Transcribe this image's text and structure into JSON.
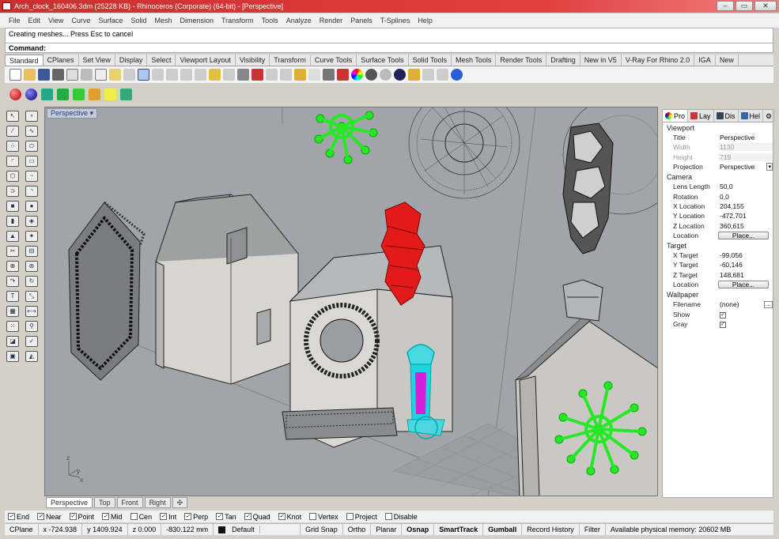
{
  "window": {
    "title": "Arch_clock_160406.3dm (25228 KB) - Rhinoceros (Corporate) (64-bit) - [Perspective]",
    "buttons": [
      "–",
      "▭",
      "✕"
    ]
  },
  "menu": [
    "File",
    "Edit",
    "View",
    "Curve",
    "Surface",
    "Solid",
    "Mesh",
    "Dimension",
    "Transform",
    "Tools",
    "Analyze",
    "Render",
    "Panels",
    "T-Splines",
    "Help"
  ],
  "command": {
    "history": "Creating meshes... Press Esc to cancel",
    "prompt": "Command:"
  },
  "toolbar_tabs": [
    "Standard",
    "CPlanes",
    "Set View",
    "Display",
    "Select",
    "Viewport Layout",
    "Visibility",
    "Transform",
    "Curve Tools",
    "Surface Tools",
    "Solid Tools",
    "Mesh Tools",
    "Render Tools",
    "Drafting",
    "New in V5",
    "V-Ray For Rhino 2.0",
    "IGA",
    "New"
  ],
  "viewport": {
    "name": "Perspective",
    "tabs": [
      "Perspective",
      "Top",
      "Front",
      "Right"
    ],
    "add": "✣",
    "axes": {
      "z": "z",
      "y": "y",
      "x": "x"
    }
  },
  "panel": {
    "tabs": [
      "Pro",
      "Lay",
      "Dis",
      "Hel"
    ],
    "viewport_header": "Viewport",
    "viewport": [
      {
        "k": "Title",
        "v": "Perspective"
      },
      {
        "k": "Width",
        "v": "1130"
      },
      {
        "k": "Height",
        "v": "719"
      },
      {
        "k": "Projection",
        "v": "Perspective"
      }
    ],
    "camera_header": "Camera",
    "camera": [
      {
        "k": "Lens Length",
        "v": "50,0"
      },
      {
        "k": "Rotation",
        "v": "0,0"
      },
      {
        "k": "X Location",
        "v": "204,155"
      },
      {
        "k": "Y Location",
        "v": "-472,701"
      },
      {
        "k": "Z Location",
        "v": "360,615"
      },
      {
        "k": "Location",
        "v": "Place..."
      }
    ],
    "target_header": "Target",
    "target": [
      {
        "k": "X Target",
        "v": "-99,056"
      },
      {
        "k": "Y Target",
        "v": "-60,146"
      },
      {
        "k": "Z Target",
        "v": "148,681"
      },
      {
        "k": "Location",
        "v": "Place..."
      }
    ],
    "wallpaper_header": "Wallpaper",
    "wallpaper": [
      {
        "k": "Filename",
        "v": "(none)"
      },
      {
        "k": "Show",
        "v": "✓"
      },
      {
        "k": "Gray",
        "v": "✓"
      }
    ]
  },
  "osnap": [
    {
      "label": "End",
      "checked": true
    },
    {
      "label": "Near",
      "checked": true
    },
    {
      "label": "Point",
      "checked": true
    },
    {
      "label": "Mid",
      "checked": true
    },
    {
      "label": "Cen",
      "checked": false
    },
    {
      "label": "Int",
      "checked": true
    },
    {
      "label": "Perp",
      "checked": true
    },
    {
      "label": "Tan",
      "checked": true
    },
    {
      "label": "Quad",
      "checked": true
    },
    {
      "label": "Knot",
      "checked": true
    },
    {
      "label": "Vertex",
      "checked": false
    },
    {
      "label": "Project",
      "checked": false
    },
    {
      "label": "Disable",
      "checked": false
    }
  ],
  "status": {
    "cplane": "CPlane",
    "x": "x -724.938",
    "y": "y 1409.924",
    "z": "z 0.000",
    "dist": "-830.122 mm",
    "layer": "Default",
    "grid_snap": "Grid Snap",
    "ortho": "Ortho",
    "planar": "Planar",
    "osnap": "Osnap",
    "smarttrack": "SmartTrack",
    "gumball": "Gumball",
    "record_history": "Record History",
    "filter": "Filter",
    "memory": "Available physical memory: 20602 MB"
  },
  "colors": {
    "viewport_bg": "#a1a4a9",
    "selected_green": "#27e827",
    "red_object": "#e21a1a",
    "cyan_object": "#1ed3e0",
    "magenta": "#d81fd8"
  }
}
